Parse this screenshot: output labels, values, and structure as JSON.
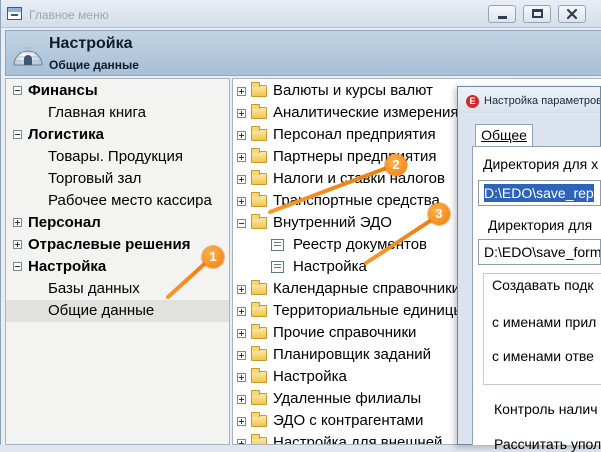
{
  "window": {
    "title": "Главное меню"
  },
  "header": {
    "title": "Настройка",
    "subtitle": "Общие данные"
  },
  "left_panel": {
    "items": [
      {
        "label": "Финансы",
        "kind": "group",
        "toggle": "minus"
      },
      {
        "label": "Главная книга",
        "kind": "item"
      },
      {
        "label": "Логистика",
        "kind": "group",
        "toggle": "minus"
      },
      {
        "label": "Товары. Продукция",
        "kind": "item"
      },
      {
        "label": "Торговый зал",
        "kind": "item"
      },
      {
        "label": "Рабочее место кассира",
        "kind": "item"
      },
      {
        "label": "Персонал",
        "kind": "group",
        "toggle": "plus"
      },
      {
        "label": "Отраслевые решения",
        "kind": "group",
        "toggle": "plus"
      },
      {
        "label": "Настройка",
        "kind": "group",
        "toggle": "minus"
      },
      {
        "label": "Базы данных",
        "kind": "item"
      },
      {
        "label": "Общие данные",
        "kind": "item",
        "selected": true
      }
    ]
  },
  "tree": {
    "items": [
      {
        "label": "Валюты и курсы валют",
        "toggle": "plus",
        "icon": "folder"
      },
      {
        "label": "Аналитические измерения",
        "toggle": "plus",
        "icon": "folder"
      },
      {
        "label": "Персонал предприятия",
        "toggle": "plus",
        "icon": "folder"
      },
      {
        "label": "Партнеры предприятия",
        "toggle": "plus",
        "icon": "folder"
      },
      {
        "label": "Налоги и ставки налогов",
        "toggle": "plus",
        "icon": "folder"
      },
      {
        "label": "Транспортные средства",
        "toggle": "plus",
        "icon": "folder"
      },
      {
        "label": "Внутренний ЭДО",
        "toggle": "minus",
        "icon": "folder"
      },
      {
        "label": "Реестр документов",
        "icon": "document",
        "child": true
      },
      {
        "label": "Настройка",
        "icon": "document",
        "child": true
      },
      {
        "label": "Календарные справочники",
        "toggle": "plus",
        "icon": "folder"
      },
      {
        "label": "Территориальные единицы",
        "toggle": "plus",
        "icon": "folder"
      },
      {
        "label": "Прочие справочники",
        "toggle": "plus",
        "icon": "folder"
      },
      {
        "label": "Планировщик заданий",
        "toggle": "plus",
        "icon": "folder"
      },
      {
        "label": "Настройка",
        "toggle": "plus",
        "icon": "folder"
      },
      {
        "label": "Удаленные филиалы",
        "toggle": "plus",
        "icon": "folder"
      },
      {
        "label": "ЭДО с контрагентами",
        "toggle": "plus",
        "icon": "folder"
      },
      {
        "label": "Настройка для внешней",
        "toggle": "plus",
        "icon": "folder"
      }
    ]
  },
  "dialog": {
    "title": "Настройка параметров",
    "icon_letter": "E",
    "tab_label": "Общее",
    "dir_label_1": "Директория для х",
    "dir_value_1": "D:\\EDO\\save_rep",
    "dir_label_2": "Директория для",
    "dir_value_2": "D:\\EDO\\save_form",
    "group_label": "Создавать подк",
    "option_1": "с именами прил",
    "option_2": "с именами отве",
    "control_label": "Контроль налич",
    "calc_label": "Рассчитать упол"
  },
  "callouts": [
    "1",
    "2",
    "3"
  ],
  "colors": {
    "callout": "#f07b0a",
    "selection": "#2d63b8"
  }
}
